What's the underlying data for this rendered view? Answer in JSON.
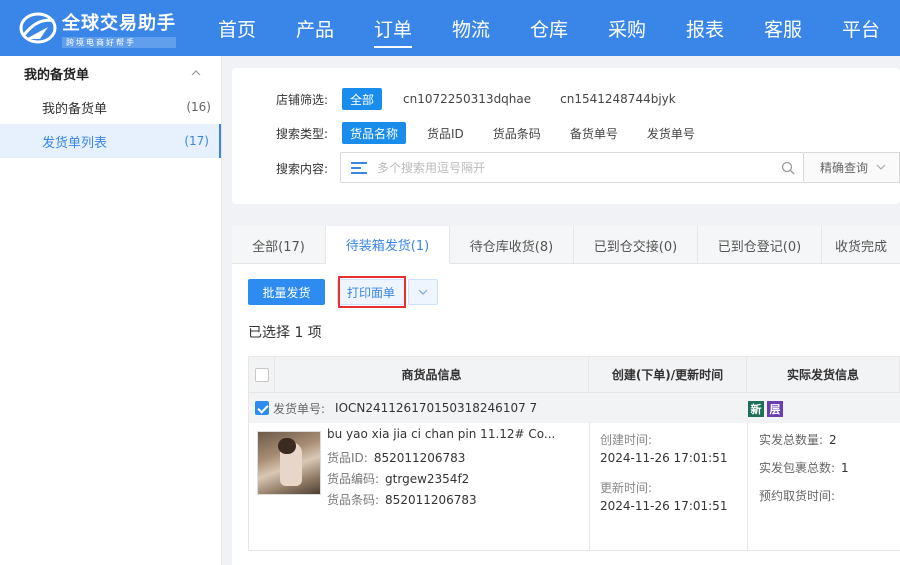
{
  "app": {
    "logo_title": "全球交易助手",
    "logo_subtitle": "跨境电商好帮手"
  },
  "nav": [
    {
      "label": "首页"
    },
    {
      "label": "产品"
    },
    {
      "label": "订单",
      "active": true
    },
    {
      "label": "物流"
    },
    {
      "label": "仓库"
    },
    {
      "label": "采购"
    },
    {
      "label": "报表"
    },
    {
      "label": "客服"
    },
    {
      "label": "平台"
    }
  ],
  "sidebar": {
    "title": "我的备货单",
    "items": [
      {
        "label": "我的备货单",
        "count": "(16)"
      },
      {
        "label": "发货单列表",
        "count": "(17)",
        "active": true
      }
    ]
  },
  "filter": {
    "store_label": "店铺筛选:",
    "stores": [
      "全部",
      "cn1072250313dqhae",
      "cn1541248744bjyk"
    ],
    "type_label": "搜索类型:",
    "types": [
      "货品名称",
      "货品ID",
      "货品条码",
      "备货单号",
      "发货单号"
    ],
    "content_label": "搜索内容:",
    "search_placeholder": "多个搜索用逗号隔开",
    "precise_label": "精确查询"
  },
  "tabs": [
    {
      "label": "全部(17)"
    },
    {
      "label": "待装箱发货(1)",
      "active": true
    },
    {
      "label": "待仓库收货(8)"
    },
    {
      "label": "已到仓交接(0)"
    },
    {
      "label": "已到仓登记(0)"
    },
    {
      "label": "收货完成"
    }
  ],
  "actions": {
    "batch_ship": "批量发货",
    "print_sheet": "打印面单"
  },
  "selected_text": "已选择 1 项",
  "table": {
    "headers": [
      "商货品信息",
      "创建(下单)/更新时间",
      "实际发货信息"
    ],
    "order": {
      "label": "发货单号:",
      "number": "IOCN241126170150318246107 7",
      "tags": [
        "新",
        "层"
      ]
    },
    "row": {
      "title": "bu yao xia jia ci chan pin 11.12# Co...",
      "id_label": "货品ID:",
      "id": "852011206783",
      "code_label": "货品编码:",
      "code": "gtrgew2354f2",
      "barcode_label": "货品条码:",
      "barcode": "852011206783",
      "created_label": "创建时间:",
      "created": "2024-11-26 17:01:51",
      "updated_label": "更新时间:",
      "updated": "2024-11-26 17:01:51",
      "ship_total_label": "实发总数量:",
      "ship_total": "2",
      "ship_pkg_label": "实发包裹总数:",
      "ship_pkg": "1",
      "pickup_label": "预约取货时间:"
    }
  },
  "colors": {
    "brand": "#3a86e8",
    "primary_button": "#2e8cf0",
    "highlight": "#e53030"
  }
}
